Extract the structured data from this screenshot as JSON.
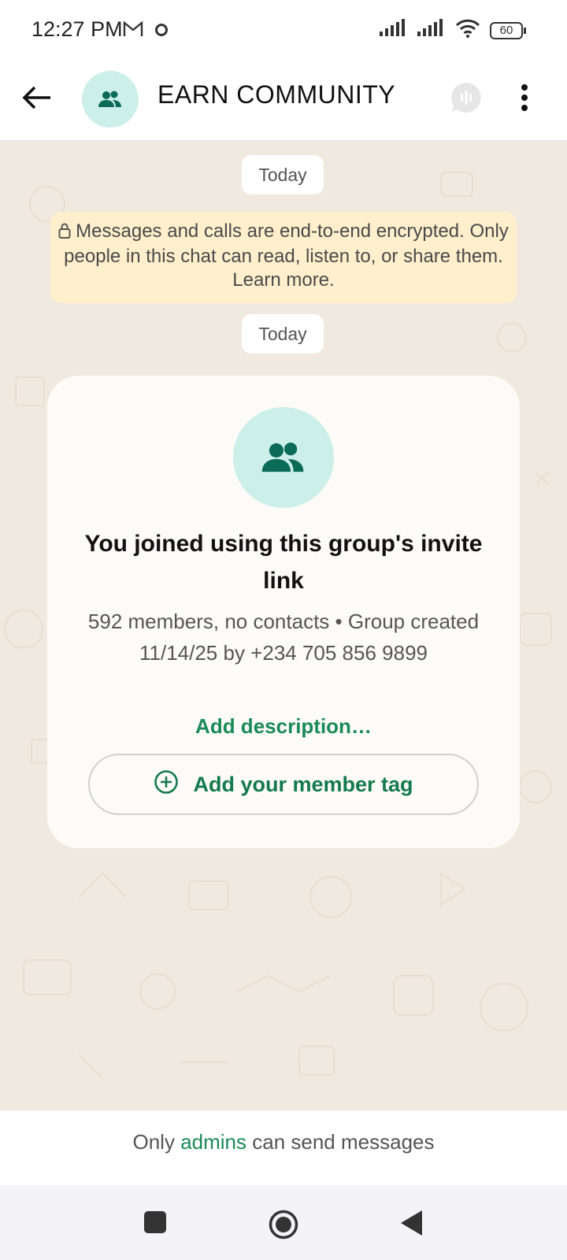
{
  "status_bar": {
    "time": "12:27 PM",
    "battery": "60"
  },
  "header": {
    "title": "EARN COMMUNITY"
  },
  "chat": {
    "date_label_1": "Today",
    "encryption_notice": "Messages and calls are end-to-end encrypted. Only people in this chat can read, listen to, or share them. Learn more.",
    "date_label_2": "Today"
  },
  "system_card": {
    "title": "You joined using this group's invite link",
    "subtitle": "592 members, no contacts • Group created 11/14/25 by +234 705 856 9899",
    "add_description": "Add description…",
    "member_tag_button": "Add your member tag"
  },
  "footer": {
    "prefix": "Only ",
    "admins": "admins",
    "suffix": " can send messages"
  },
  "colors": {
    "accent": "#1a8a59",
    "avatar_bg": "#ccefe9",
    "notice_bg": "#ffefcc"
  }
}
